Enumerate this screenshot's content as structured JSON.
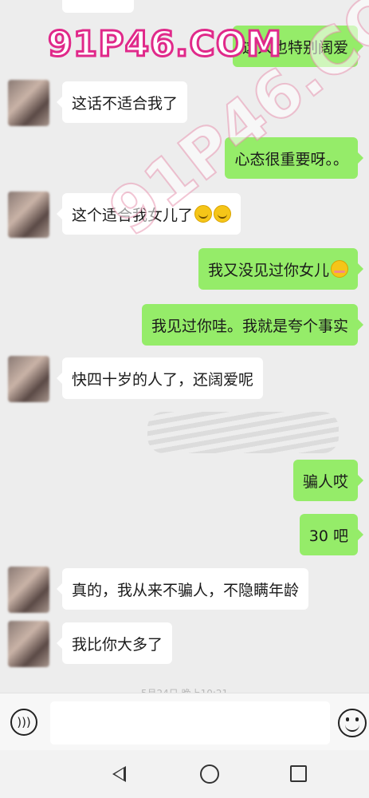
{
  "watermark": "91P46.COM",
  "watermark_diagonal": "91P46.COM",
  "messages": [
    {
      "side": "out",
      "text": "这人也特别阔爱"
    },
    {
      "side": "in",
      "text": "这话不适合我了"
    },
    {
      "side": "out",
      "text": "心态很重要呀。。"
    },
    {
      "side": "in",
      "text": "这个适合我女儿了"
    },
    {
      "side": "out",
      "text": "我又没见过你女儿"
    },
    {
      "side": "out",
      "text": "我见过你哇。我就是夸个事实"
    },
    {
      "side": "in",
      "text": "快四十岁的人了，还阔爱呢"
    },
    {
      "side": "out",
      "text": "骗人哎"
    },
    {
      "side": "out",
      "text": "30 吧"
    },
    {
      "side": "in",
      "text": "真的，我从来不骗人，不隐瞒年龄"
    },
    {
      "side": "in",
      "text": "我比你大多了"
    }
  ],
  "timestamp": "5月24日 晚上10:21",
  "colors": {
    "outgoing": "#95ec69",
    "incoming": "#ffffff",
    "background": "#ededed"
  },
  "icons": {
    "voice": "voice-icon",
    "emoji": "emoji-icon",
    "back": "back-icon",
    "home": "home-icon",
    "recent": "recent-apps-icon"
  }
}
